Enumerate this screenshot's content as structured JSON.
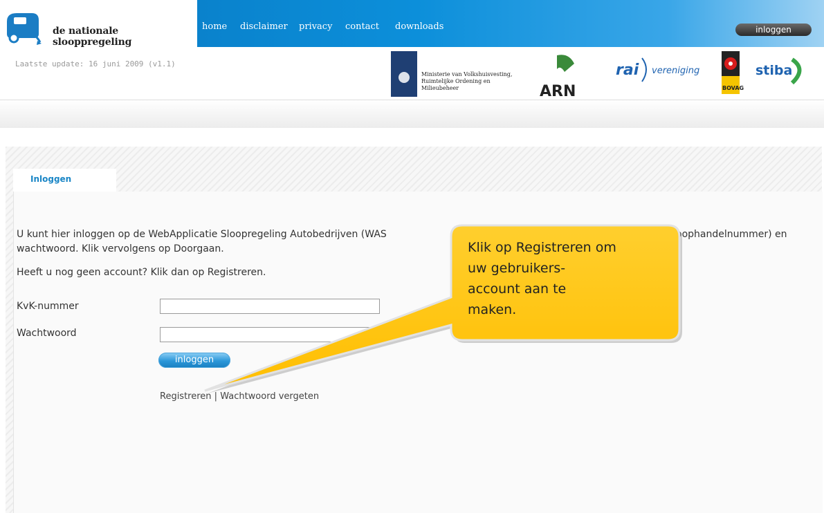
{
  "brand": {
    "name": "de nationale slooppregeling"
  },
  "nav": {
    "items": [
      "home",
      "disclaimer",
      "privacy",
      "contact",
      "downloads"
    ],
    "login_label": "inloggen"
  },
  "update_text": "Laatste update: 16 juni 2009 (v1.1)",
  "logos": {
    "ministry": [
      "Ministerie van Volkshuisvesting,",
      "Ruimtelijke Ordening en",
      "Milieubeheer"
    ],
    "arn": "ARN",
    "rai_left": "rai",
    "rai_right": "vereniging",
    "bovag": "BOVAG",
    "stiba": "stiba"
  },
  "tab": {
    "label": "Inloggen"
  },
  "intro": {
    "line1a": "U kunt hier inloggen op de WebApplicatie Sloopregeling Autobedrijven (WAS",
    "line1b": "oophandelnummer) en",
    "line2": "wachtwoord. Klik vervolgens op Doorgaan.",
    "line3": "Heeft u nog geen account? Klik dan op Registreren."
  },
  "form": {
    "kvk_label": "KvK-nummer",
    "kvk_value": "",
    "password_label": "Wachtwoord",
    "password_value": "",
    "submit_label": "inloggen"
  },
  "links": {
    "register": "Registreren",
    "separator": " | ",
    "forgot": "Wachtwoord vergeten"
  },
  "callout": {
    "lines": [
      "Klik op Registreren om",
      "uw gebruikers-",
      "account aan te",
      "maken."
    ]
  },
  "colors": {
    "nav_blue": "#0a82cc",
    "callout_fill": "#ffc61a",
    "link_blue": "#1a86c6"
  }
}
